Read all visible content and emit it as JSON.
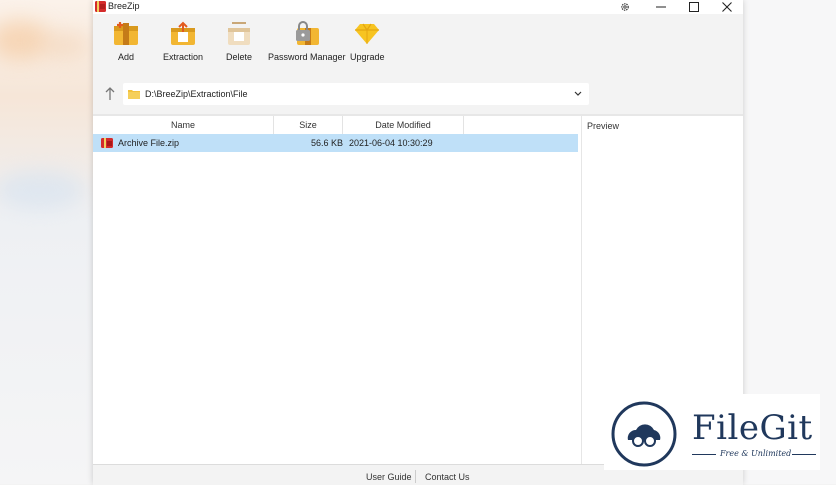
{
  "app": {
    "title": "BreeZip"
  },
  "toolbar": {
    "add": "Add",
    "extraction": "Extraction",
    "delete": "Delete",
    "password_manager": "Password Manager",
    "upgrade": "Upgrade"
  },
  "address": {
    "path": "D:\\BreeZip\\Extraction\\File"
  },
  "columns": {
    "name": "Name",
    "size": "Size",
    "date_modified": "Date Modified"
  },
  "files": [
    {
      "name": "Archive File.zip",
      "size": "56.6 KB",
      "date_modified": "2021-06-04 10:30:29"
    }
  ],
  "preview": {
    "label": "Preview"
  },
  "status": {
    "user_guide": "User Guide",
    "contact_us": "Contact Us"
  },
  "watermark": {
    "brand": "FileGit",
    "tagline": "Free & Unlimited"
  },
  "colors": {
    "selected_row": "#bfe0f8",
    "toolbar_bg": "#f3f3f3",
    "brand_navy": "#20385c",
    "icon_gold": "#f2b632"
  }
}
